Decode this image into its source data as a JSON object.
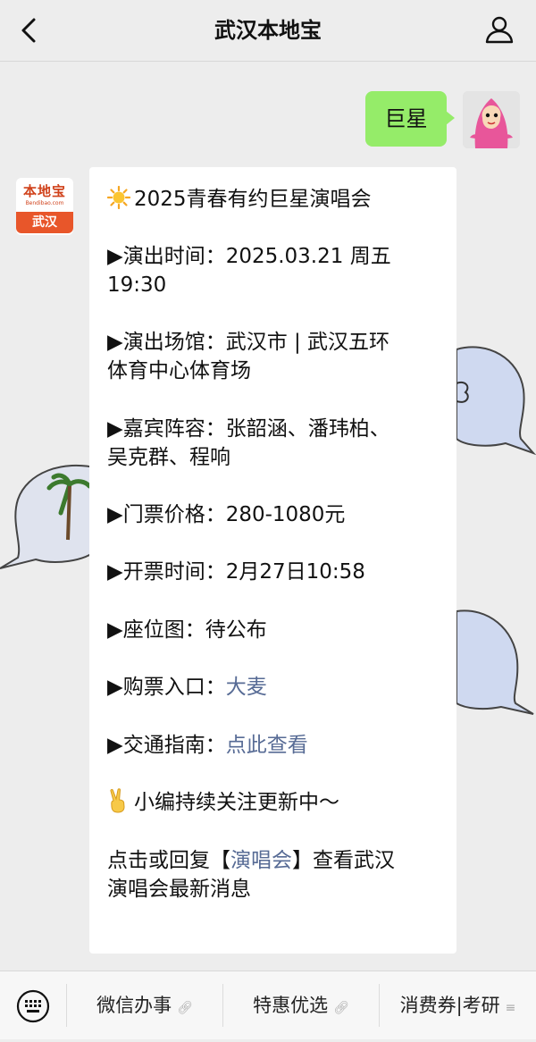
{
  "header": {
    "title": "武汉本地宝"
  },
  "chat": {
    "outgoing": {
      "text": "巨星"
    },
    "bot": {
      "logo_top": "本地宝",
      "logo_url": "Bendibao.com",
      "logo_city": "武汉"
    },
    "message": {
      "l1": "2025青春有约巨星演唱会",
      "l2": "▶演出时间：2025.03.21 周五",
      "l3": "19:30",
      "l4": "▶演出场馆：武汉市 | 武汉五环",
      "l5": "体育中心体育场",
      "l6": "▶嘉宾阵容：张韶涵、潘玮柏、",
      "l7": "吴克群、程响",
      "l8": "▶门票价格：280-1080元",
      "l9": "▶开票时间：2月27日10:58",
      "l10": "▶座位图：待公布",
      "l11_prefix": "▶购票入口：",
      "l11_link": "大麦",
      "l12_prefix": "▶交通指南：",
      "l12_link": "点此查看",
      "l13": "小编持续关注更新中～",
      "l14_a": "点击或回复【",
      "l14_link": "演唱会",
      "l14_b": "】查看武汉",
      "l15": "演唱会最新消息"
    }
  },
  "menu": {
    "items": [
      {
        "label": "微信办事"
      },
      {
        "label": "特惠优选"
      },
      {
        "label": "消费券|考研"
      }
    ]
  },
  "colors": {
    "link": "#576b95",
    "outgoing_bubble": "#95ec69",
    "brand": "#e8562a"
  }
}
